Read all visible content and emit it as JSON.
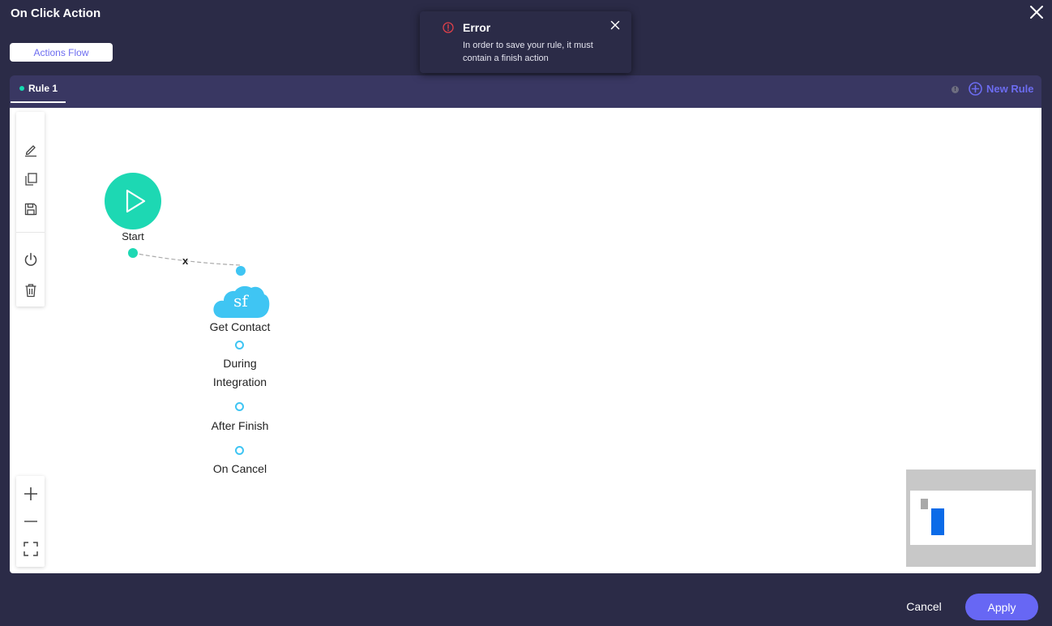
{
  "dialog": {
    "title": "On Click Action"
  },
  "tabs": {
    "actions_flow": "Actions Flow"
  },
  "rules": {
    "active_tab": "Rule 1",
    "info_glyph": "!",
    "new_rule": "New Rule"
  },
  "toolbar": {
    "icons": [
      "pencil-icon",
      "copy-icon",
      "save-icon",
      "power-icon",
      "trash-icon"
    ]
  },
  "zoom": {
    "icons": [
      "plus-icon",
      "minus-icon",
      "fit-screen-icon"
    ]
  },
  "flow": {
    "start_label": "Start",
    "edge_label": "x",
    "action": {
      "icon_text": "sf",
      "label": "Get Contact",
      "outputs": [
        "During\nIntegration",
        "After Finish",
        "On Cancel"
      ]
    }
  },
  "toast": {
    "title": "Error",
    "message": "In order to save your rule, it must contain a finish action"
  },
  "footer": {
    "cancel": "Cancel",
    "apply": "Apply"
  },
  "colors": {
    "background": "#2b2b47",
    "rule_bar": "#393762",
    "accent": "#6767f4",
    "start_node": "#1dd8b3",
    "salesforce": "#3fc5f3",
    "error": "#e0404a",
    "minimap_viewport": "#0b6be8"
  }
}
